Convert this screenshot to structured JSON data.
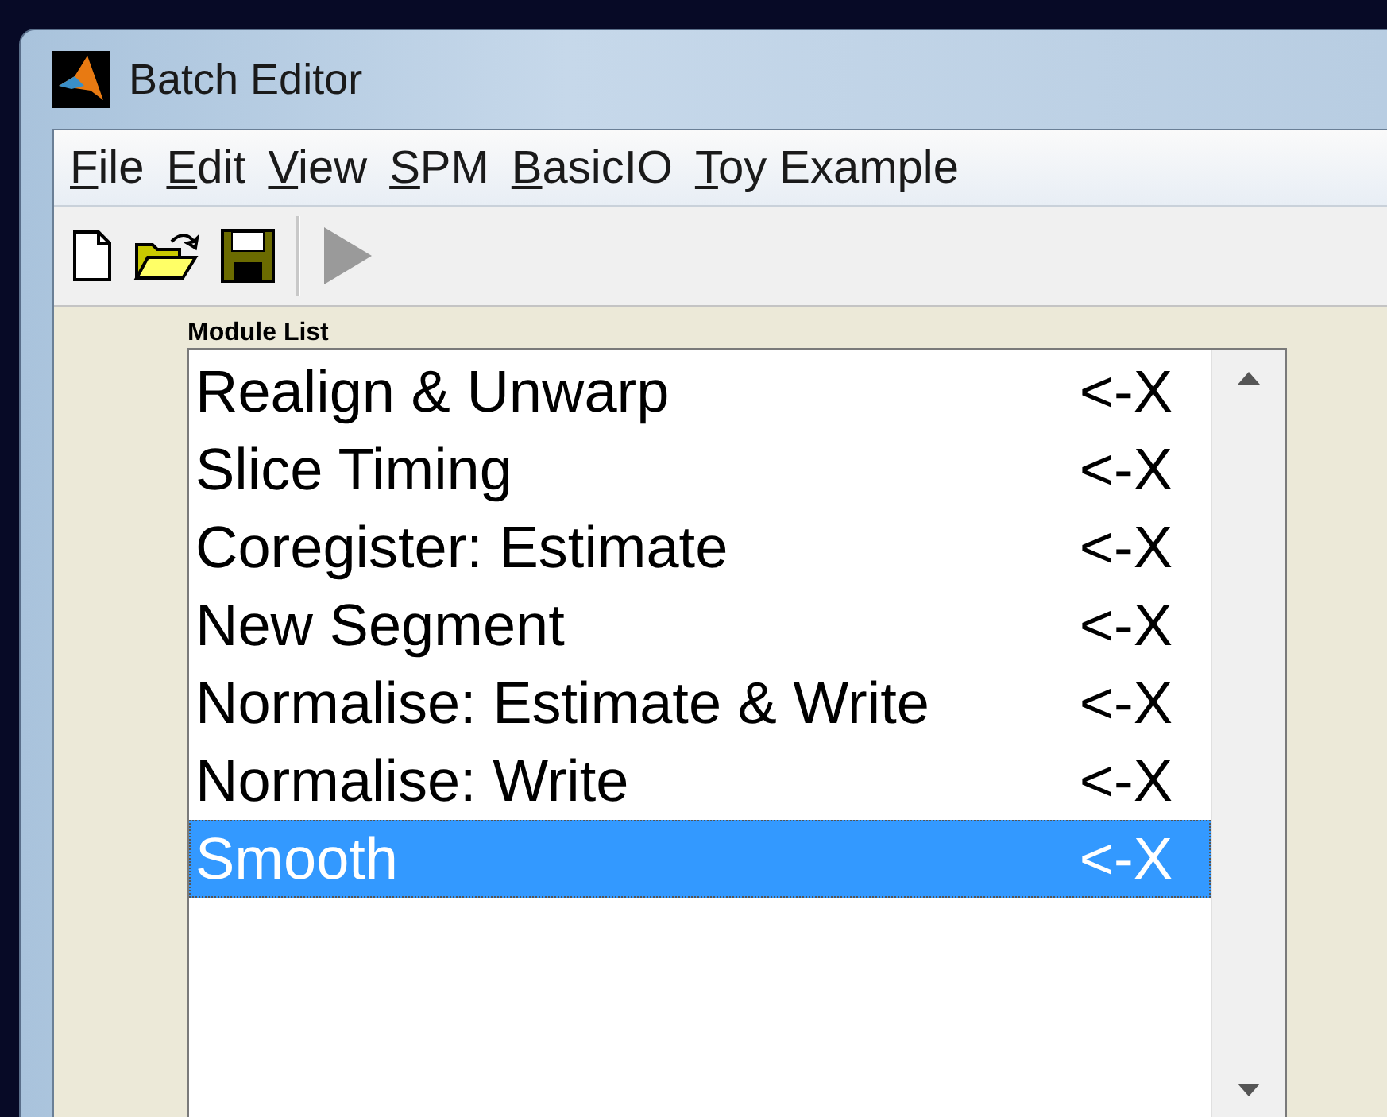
{
  "window": {
    "title": "Batch Editor"
  },
  "menu": [
    {
      "label": "File"
    },
    {
      "label": "Edit"
    },
    {
      "label": "View"
    },
    {
      "label": "SPM"
    },
    {
      "label": "BasicIO"
    },
    {
      "label": "Toy Example"
    }
  ],
  "toolbar": [
    {
      "kind": "new",
      "disabled": false
    },
    {
      "kind": "open",
      "disabled": false
    },
    {
      "kind": "save",
      "disabled": false
    },
    {
      "kind": "separator"
    },
    {
      "kind": "run",
      "disabled": true
    }
  ],
  "module_list": {
    "label": "Module List",
    "items": [
      {
        "name": "Realign & Unwarp",
        "remove": "<-X",
        "selected": false
      },
      {
        "name": "Slice Timing",
        "remove": "<-X",
        "selected": false
      },
      {
        "name": "Coregister: Estimate",
        "remove": "<-X",
        "selected": false
      },
      {
        "name": "New Segment",
        "remove": "<-X",
        "selected": false
      },
      {
        "name": "Normalise: Estimate & Write",
        "remove": "<-X",
        "selected": false
      },
      {
        "name": "Normalise: Write",
        "remove": "<-X",
        "selected": false
      },
      {
        "name": "Smooth",
        "remove": "<-X",
        "selected": true
      }
    ]
  }
}
